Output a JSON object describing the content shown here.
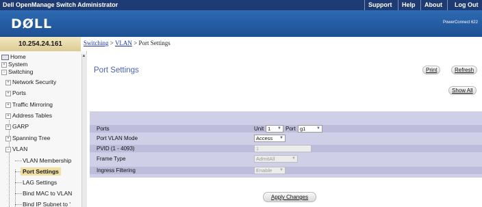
{
  "app_title": "Dell OpenManage Switch Administrator",
  "top_links": [
    "Support",
    "Help",
    "About",
    "Log Out"
  ],
  "brand": {
    "logo": "DØLL",
    "model": "PowerConnect 622"
  },
  "ip_address": "10.254.24.161",
  "breadcrumb": {
    "switching": "Switching",
    "sep1": " > ",
    "vlan": "VLAN",
    "sep2": " > ",
    "current": "Port Settings"
  },
  "sidebar": {
    "items": [
      {
        "label": "Home",
        "icon": "home-icon",
        "level": 0
      },
      {
        "label": "System",
        "icon": "plus-box-icon",
        "level": 0
      },
      {
        "label": "Switching",
        "icon": "minus-box-icon",
        "level": 0
      },
      {
        "label": "Network Security",
        "icon": "plus-box-icon",
        "level": 1
      },
      {
        "label": "Ports",
        "icon": "plus-box-icon",
        "level": 1
      },
      {
        "label": "Traffic Mirroring",
        "icon": "plus-box-icon",
        "level": 1
      },
      {
        "label": "Address Tables",
        "icon": "plus-box-icon",
        "level": 1
      },
      {
        "label": "GARP",
        "icon": "plus-box-icon",
        "level": 1
      },
      {
        "label": "Spanning Tree",
        "icon": "plus-box-icon",
        "level": 1
      },
      {
        "label": "VLAN",
        "icon": "minus-box-icon",
        "level": 1
      },
      {
        "label": "VLAN Membership",
        "level": 2
      },
      {
        "label": "Port Settings",
        "level": 2,
        "active": true
      },
      {
        "label": "LAG Settings",
        "level": 2
      },
      {
        "label": "Bind MAC to VLAN",
        "level": 2
      },
      {
        "label": "Bind IP Subnet to '",
        "level": 2
      }
    ]
  },
  "page": {
    "title": "Port Settings",
    "buttons": {
      "print": "Print",
      "refresh": "Refresh",
      "show_all": "Show All",
      "apply": "Apply Changes"
    }
  },
  "form": {
    "ports": {
      "label": "Ports",
      "unit_label": "Unit",
      "unit_value": "1",
      "port_label": "Port",
      "port_value": "g1"
    },
    "port_vlan_mode": {
      "label": "Port VLAN Mode",
      "value": "Access"
    },
    "pvid": {
      "label": "PVID (1 - 4093)",
      "value": "1"
    },
    "frame_type": {
      "label": "Frame Type",
      "value": "AdmitAll"
    },
    "ingress_filtering": {
      "label": "Ingress Filtering",
      "value": "Enable"
    }
  },
  "colors": {
    "topbar": "#1e3c73",
    "brand": "#2e6bb3",
    "panel": "#cfcfe7",
    "title": "#4a62b8",
    "active_nav": "#f1dfa2"
  }
}
